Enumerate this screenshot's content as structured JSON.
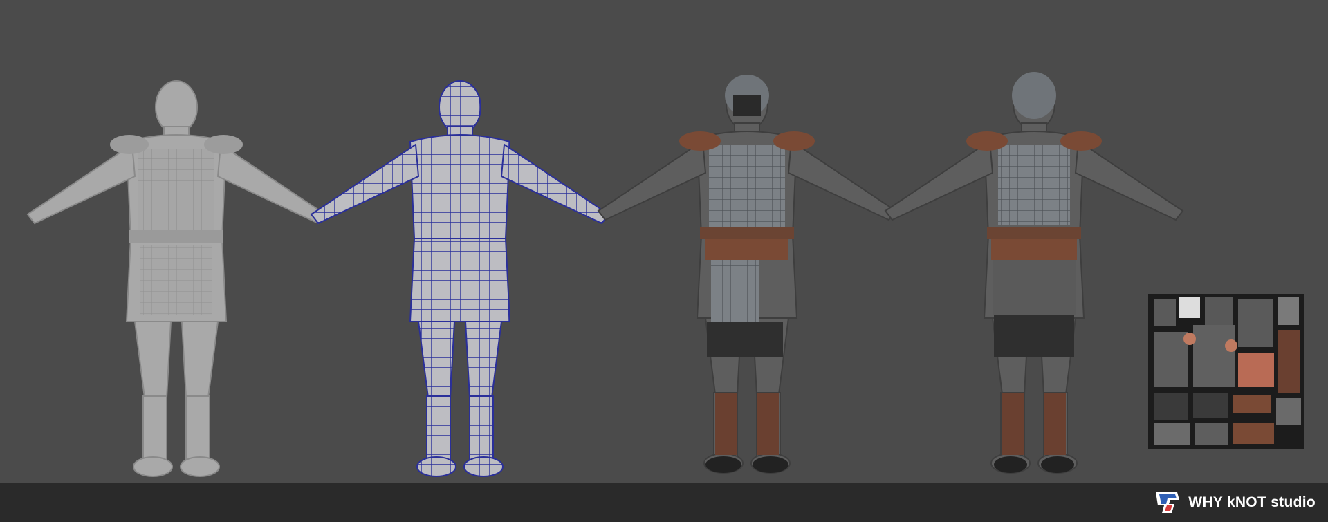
{
  "brand": {
    "name": "WHY kNOT studio",
    "logo_icon": "why-knot-logo-icon"
  },
  "figures": [
    {
      "name": "sculpt",
      "material": "clay",
      "color": "#a9a9a9"
    },
    {
      "name": "wireframe",
      "material": "wire",
      "color": "#2a2f9a"
    },
    {
      "name": "textured-front",
      "material": "textured",
      "color": "#5b5b5b"
    },
    {
      "name": "textured-back",
      "material": "textured",
      "color": "#5b5b5b"
    }
  ],
  "colors": {
    "background": "#4b4b4b",
    "footer": "#2a2a2a",
    "leather": "#7a4a35",
    "metal": "#6f7479",
    "pants": "#2f2f2f"
  }
}
